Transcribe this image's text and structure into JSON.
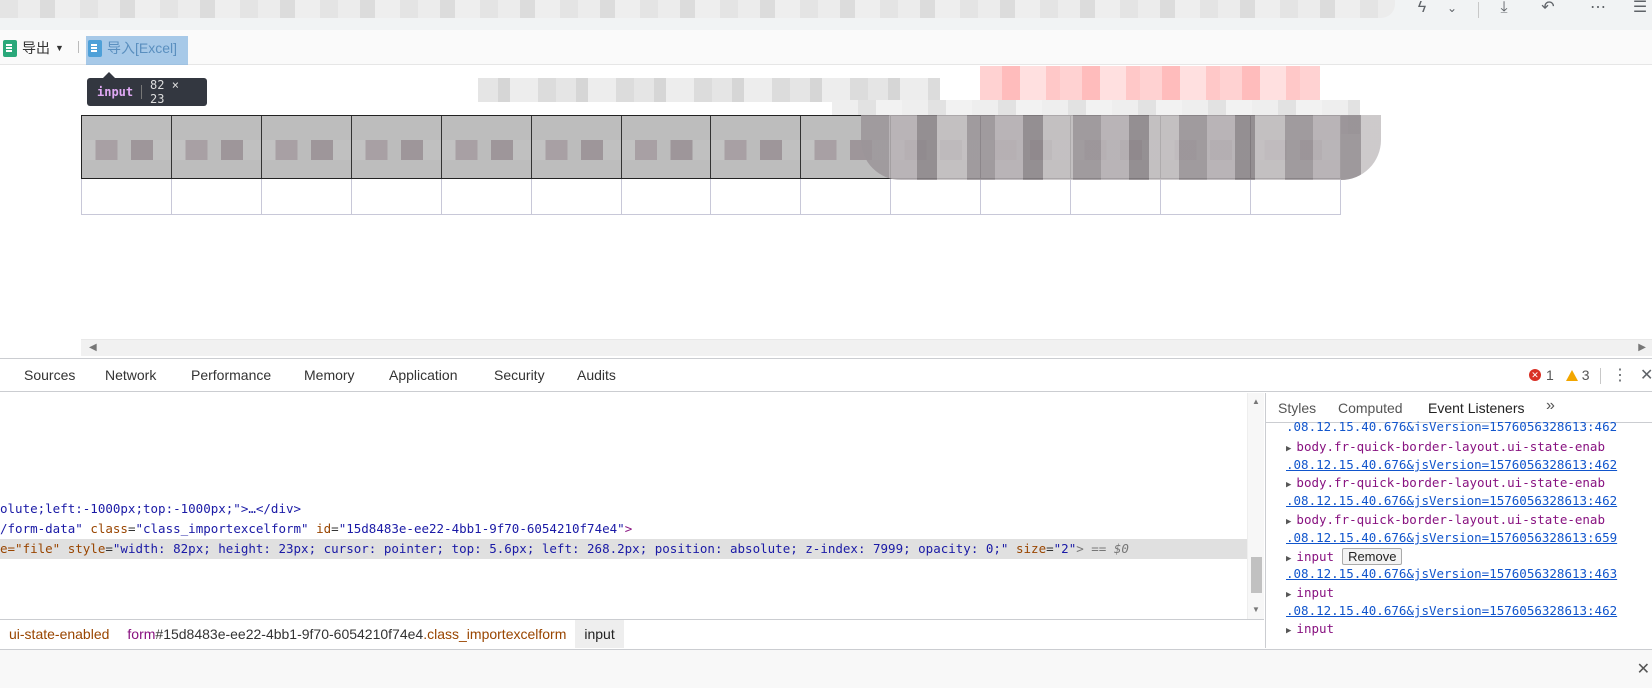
{
  "browser": {
    "icons": {
      "lightning": "lightning-icon",
      "chevron": "chevron-down-icon",
      "download": "download-icon",
      "undo": "undo-icon",
      "more": "more-icon",
      "menu": "hamburger-icon"
    }
  },
  "app_toolbar": {
    "export_label": "导出",
    "import_label": "导入[Excel]"
  },
  "tooltip": {
    "tag": "input",
    "size": "82 × 23"
  },
  "devtools": {
    "tabs": [
      "Sources",
      "Network",
      "Performance",
      "Memory",
      "Application",
      "Security",
      "Audits"
    ],
    "error_count": "1",
    "warning_count": "3",
    "elements": {
      "line1": "olute;left:-1000px;top:-1000px;\">…</div>",
      "line2_prefix": "/form-data\" ",
      "line2_class_attr": "class",
      "line2_class_val": "\"class_importexcelform\"",
      "line2_id_attr": "id",
      "line2_id_val": "\"15d8483e-ee22-4bb1-9f70-6054210f74e4\"",
      "line2_end": ">",
      "line3_prefix": "e=\"file\" ",
      "line3_style_attr": "style",
      "line3_style_val": "\"width: 82px; height: 23px; cursor: pointer; top: 5.6px; left: 268.2px; position: absolute; z-index: 7999; opacity: 0;\"",
      "line3_size_attr": "size",
      "line3_size_val": "\"2\"",
      "line3_end": "> == $0"
    },
    "breadcrumbs": {
      "body_cls": "ui-state-enabled",
      "form_tag": "form",
      "form_id": "#15d8483e-ee22-4bb1-9f70-6054210f74e4",
      "form_cls": ".class_importexcelform",
      "input_tag": "input"
    },
    "sidebar": {
      "tabs": [
        "Styles",
        "Computed",
        "Event Listeners"
      ],
      "more": "»",
      "links": [
        ".08.12.15.40.676&jsVersion=1576056328613:462",
        ".08.12.15.40.676&jsVersion=1576056328613:462",
        ".08.12.15.40.676&jsVersion=1576056328613:462",
        ".08.12.15.40.676&jsVersion=1576056328613:659",
        ".08.12.15.40.676&jsVersion=1576056328613:463",
        ".08.12.15.40.676&jsVersion=1576056328613:462"
      ],
      "listeners": [
        "body.fr-quick-border-layout.ui-state-enab",
        "body.fr-quick-border-layout.ui-state-enab",
        "body.fr-quick-border-layout.ui-state-enab",
        "input",
        "input",
        "input"
      ],
      "remove_label": "Remove"
    }
  }
}
